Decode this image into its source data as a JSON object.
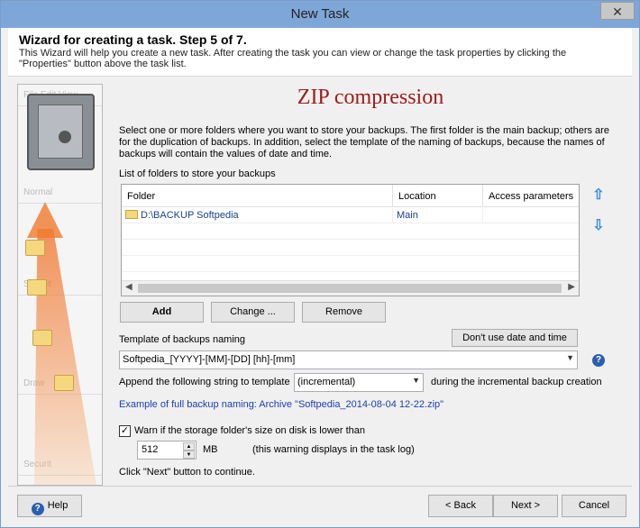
{
  "window": {
    "title": "New Task",
    "close_glyph": "✕"
  },
  "header": {
    "heading": "Wizard for creating a task. Step 5 of 7.",
    "description": "This Wizard will help you create a new task. After creating the task you can view or change the task properties by clicking the \"Properties\" button above the task list."
  },
  "sidebar": {
    "items": [
      "File  Edit  View",
      "Normal",
      "",
      "Securit",
      "",
      "",
      "Draw",
      "Securit"
    ]
  },
  "main": {
    "title": "ZIP compression",
    "intro": "Select one or more folders where you want to store your backups. The first folder is the main backup; others are for the duplication of backups. In addition, select the template of the naming of backups, because the names of backups will contain the values of date and time.",
    "list_label": "List of folders to store your backups",
    "columns": [
      "Folder",
      "Location",
      "Access parameters"
    ],
    "rows": [
      {
        "folder": "D:\\BACKUP Softpedia",
        "location": "Main",
        "access": ""
      }
    ],
    "add_label": "Add",
    "change_label": "Change ...",
    "remove_label": "Remove",
    "template_label": "Template of backups naming",
    "no_date_label": "Don't use date and time",
    "template_value": "Softpedia_[YYYY]-[MM]-[DD] [hh]-[mm]",
    "append_label": "Append the following string to template",
    "append_value": "(incremental)",
    "append_suffix": "during the incremental backup creation",
    "example": "Example of full backup naming: Archive \"Softpedia_2014-08-04 12-22.zip\"",
    "warn_label": "Warn if the storage folder's size on disk is lower than",
    "warn_checked": "✓",
    "warn_value": "512",
    "warn_unit": "MB",
    "warn_note": "(this warning displays in the task log)",
    "next_hint": "Click \"Next\" button to continue."
  },
  "footer": {
    "help_label": "Help",
    "back_label": "< Back",
    "next_label": "Next >",
    "cancel_label": "Cancel"
  }
}
